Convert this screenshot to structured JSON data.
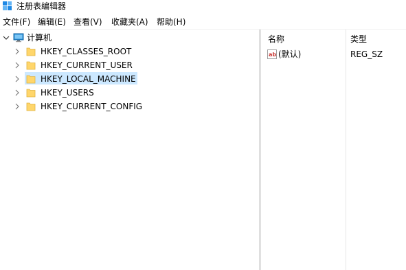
{
  "window": {
    "title": "注册表编辑器",
    "icon": "regedit-icon"
  },
  "menu": {
    "items": [
      {
        "label": "文件(F)"
      },
      {
        "label": "编辑(E)"
      },
      {
        "label": "查看(V)"
      },
      {
        "label": "收藏夹(A)"
      },
      {
        "label": "帮助(H)"
      }
    ]
  },
  "tree": {
    "root": {
      "label": "计算机",
      "icon": "computer-icon",
      "expanded": true
    },
    "children": [
      {
        "label": "HKEY_CLASSES_ROOT",
        "icon": "folder-icon",
        "expandable": true
      },
      {
        "label": "HKEY_CURRENT_USER",
        "icon": "folder-icon",
        "expandable": true
      },
      {
        "label": "HKEY_LOCAL_MACHINE",
        "icon": "folder-icon",
        "expandable": true,
        "selected": true
      },
      {
        "label": "HKEY_USERS",
        "icon": "folder-icon",
        "expandable": true
      },
      {
        "label": "HKEY_CURRENT_CONFIG",
        "icon": "folder-icon",
        "expandable": true
      }
    ]
  },
  "list": {
    "columns": [
      "名称",
      "类型"
    ],
    "rows": [
      {
        "name": "(默认)",
        "type": "REG_SZ",
        "icon": "string-value-icon"
      }
    ]
  },
  "colors": {
    "selection": "#cce8ff",
    "folder": "#ffd66b",
    "value_icon_red": "#c8322f"
  }
}
